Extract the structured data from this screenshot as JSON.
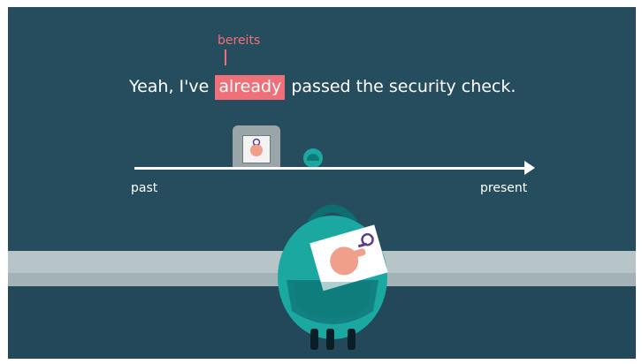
{
  "lesson": {
    "gloss": "bereits",
    "sentence_before": "Yeah, I've",
    "highlight_word": "already",
    "sentence_after": "passed the security check."
  },
  "timeline": {
    "start_label": "past",
    "end_label": "present"
  },
  "colors": {
    "background": "#264d5e",
    "accent": "#f0707a",
    "teal": "#1aa8a0",
    "belt": "#b8c5c8"
  }
}
